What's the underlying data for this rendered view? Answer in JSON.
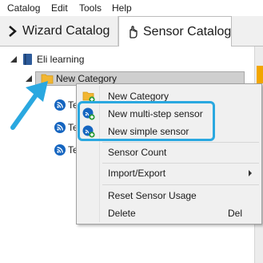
{
  "menu": [
    "Catalog",
    "Edit",
    "Tools",
    "Help"
  ],
  "tabs": {
    "wizard": "Wizard Catalog",
    "sensor": "Sensor Catalog"
  },
  "tree": {
    "root": "Eli learning",
    "category": "New Category",
    "children": [
      "Te",
      "Te",
      "Te"
    ]
  },
  "context_menu": {
    "new_category": "New Category",
    "new_multi_step": "New multi-step sensor",
    "new_simple": "New simple sensor",
    "sensor_count": "Sensor Count",
    "import_export": "Import/Export",
    "reset_usage": "Reset Sensor Usage",
    "delete": "Delete",
    "delete_shortcut": "Del"
  },
  "colors": {
    "accent_blue": "#2aa8e0",
    "folder": "#f2b632",
    "sensor_icon": "#1565c0",
    "selected_row": "#cfcfcf"
  }
}
